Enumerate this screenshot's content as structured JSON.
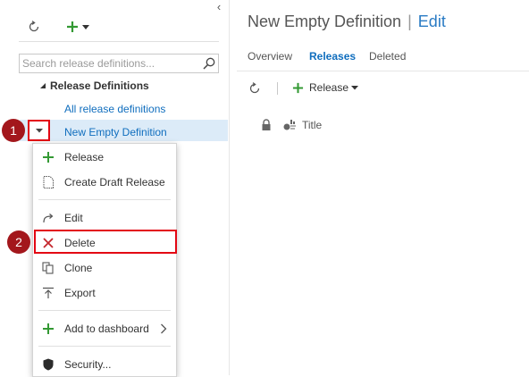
{
  "sidebar": {
    "collapse_glyph": "‹",
    "search_placeholder": "Search release definitions...",
    "tree_header": "Release Definitions",
    "items": [
      {
        "label": "All release definitions"
      },
      {
        "label": "New Empty Definition"
      }
    ]
  },
  "callouts": {
    "one": "1",
    "two": "2"
  },
  "context_menu": {
    "items": [
      {
        "label": "Release",
        "icon": "plus-icon"
      },
      {
        "label": "Create Draft Release",
        "icon": "page-icon"
      },
      {
        "label": "Edit",
        "icon": "edit-arrow-icon"
      },
      {
        "label": "Delete",
        "icon": "x-icon"
      },
      {
        "label": "Clone",
        "icon": "clone-icon"
      },
      {
        "label": "Export",
        "icon": "export-icon"
      },
      {
        "label": "Add to dashboard",
        "icon": "plus-icon"
      },
      {
        "label": "Security...",
        "icon": "shield-icon"
      }
    ]
  },
  "main": {
    "title": "New Empty Definition",
    "separator": "|",
    "title_action": "Edit",
    "tabs": [
      {
        "label": "Overview",
        "active": false
      },
      {
        "label": "Releases",
        "active": true
      },
      {
        "label": "Deleted",
        "active": false
      }
    ],
    "toolbar": {
      "release_label": "Release"
    },
    "table_header": {
      "title": "Title"
    }
  },
  "colors": {
    "accent": "#106ebe",
    "add_green": "#339933",
    "callout": "#a3171c",
    "highlight_frame": "#e30613",
    "selected_row": "#dcebf8"
  }
}
